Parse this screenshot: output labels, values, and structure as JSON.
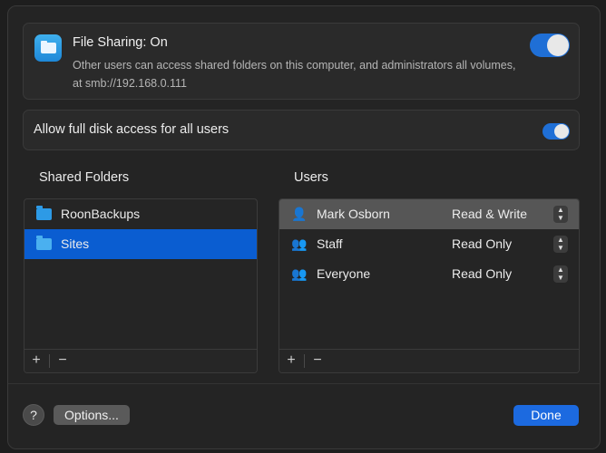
{
  "file_sharing": {
    "title": "File Sharing: On",
    "description": "Other users can access shared folders on this computer, and administrators all volumes, at smb://192.168.0.111",
    "enabled": true,
    "icon": "folder-app-icon"
  },
  "disk_access": {
    "label": "Allow full disk access for all users",
    "enabled": true
  },
  "shared_folders": {
    "heading": "Shared Folders",
    "items": [
      {
        "name": "RoonBackups",
        "selected": false
      },
      {
        "name": "Sites",
        "selected": true
      }
    ],
    "add_label": "+",
    "remove_label": "−"
  },
  "users": {
    "heading": "Users",
    "items": [
      {
        "name": "Mark Osborn",
        "icon": "person-icon",
        "glyph": "👤",
        "permission": "Read & Write",
        "selected": true
      },
      {
        "name": "Staff",
        "icon": "group-icon",
        "glyph": "👥",
        "permission": "Read Only",
        "selected": false
      },
      {
        "name": "Everyone",
        "icon": "everyone-icon",
        "glyph": "👥",
        "permission": "Read Only",
        "selected": false
      }
    ],
    "add_label": "+",
    "remove_label": "−"
  },
  "footer": {
    "help_label": "?",
    "options_label": "Options...",
    "done_label": "Done"
  },
  "colors": {
    "accent": "#1c6ae0",
    "selection": "#0a5dd1",
    "background": "#242424"
  }
}
